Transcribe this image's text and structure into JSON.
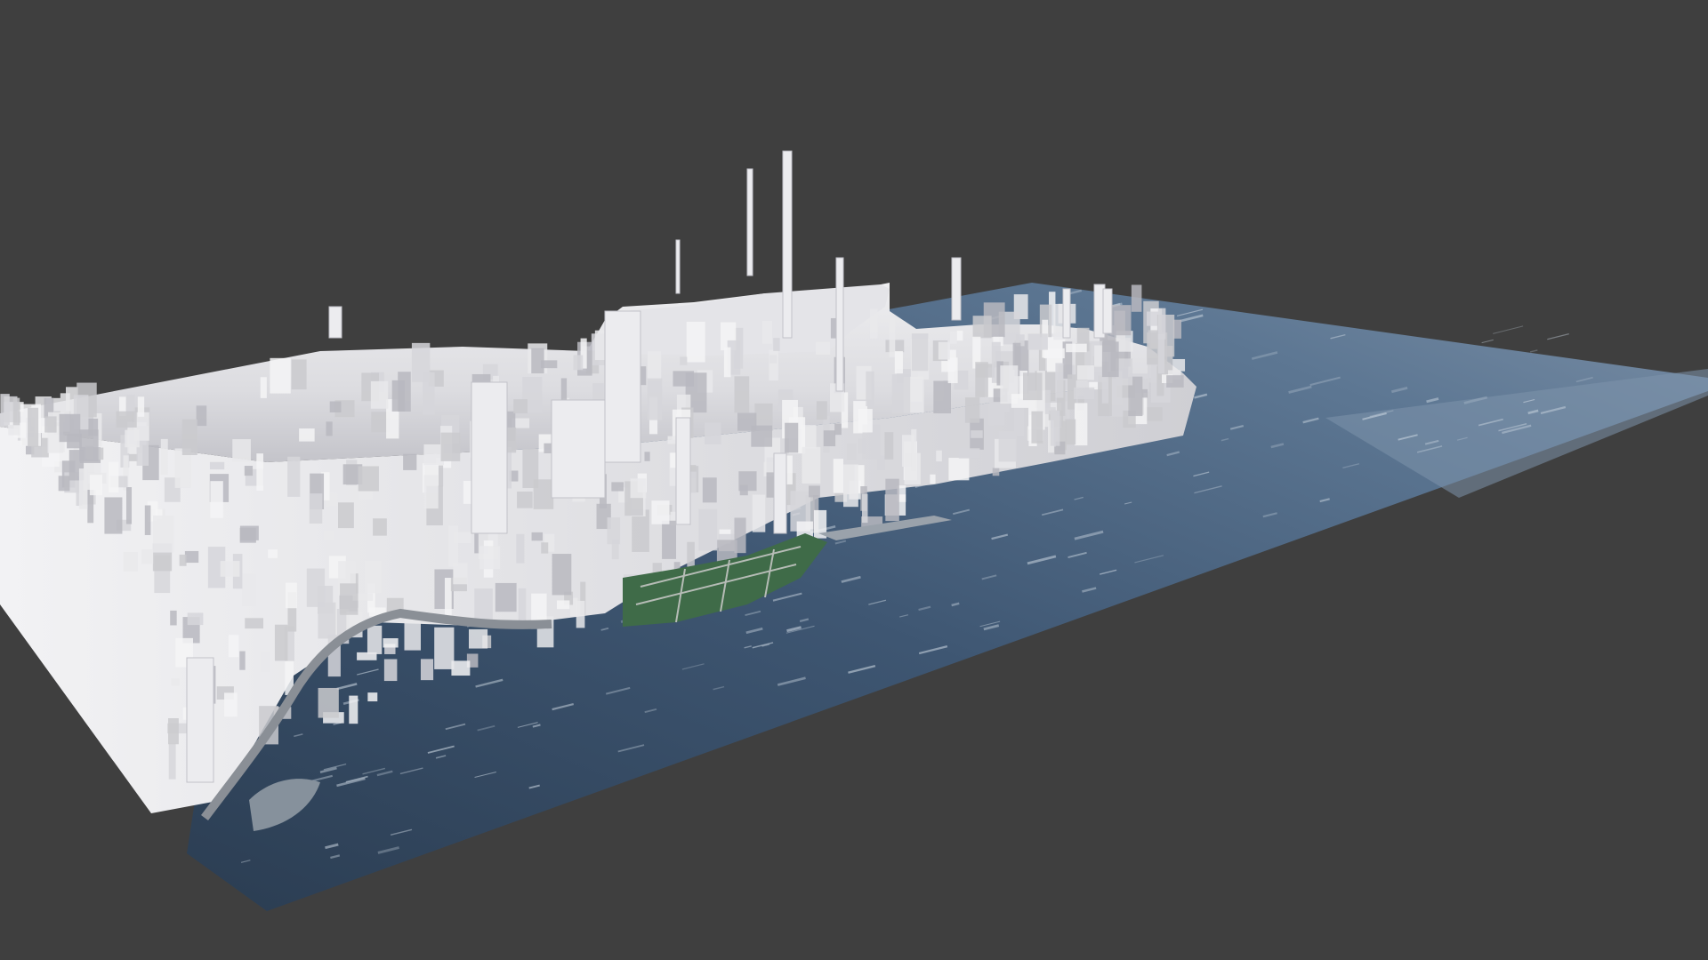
{
  "viewport": {
    "background_color": "#3f3f3f"
  },
  "scene": {
    "content": "3d-city-model",
    "colors": {
      "water_deep": "#2b3d52",
      "water_mid": "#3e5672",
      "water_light": "#62809e",
      "water_far": "#7b8fa6",
      "wave_highlight": "#c9d4df",
      "building_light": "#e9e9eb",
      "building_mid": "#d6d6da",
      "building_shadow": "#b9b9bf",
      "park_green": "#3f6b48",
      "shore": "#7a7f86"
    }
  }
}
